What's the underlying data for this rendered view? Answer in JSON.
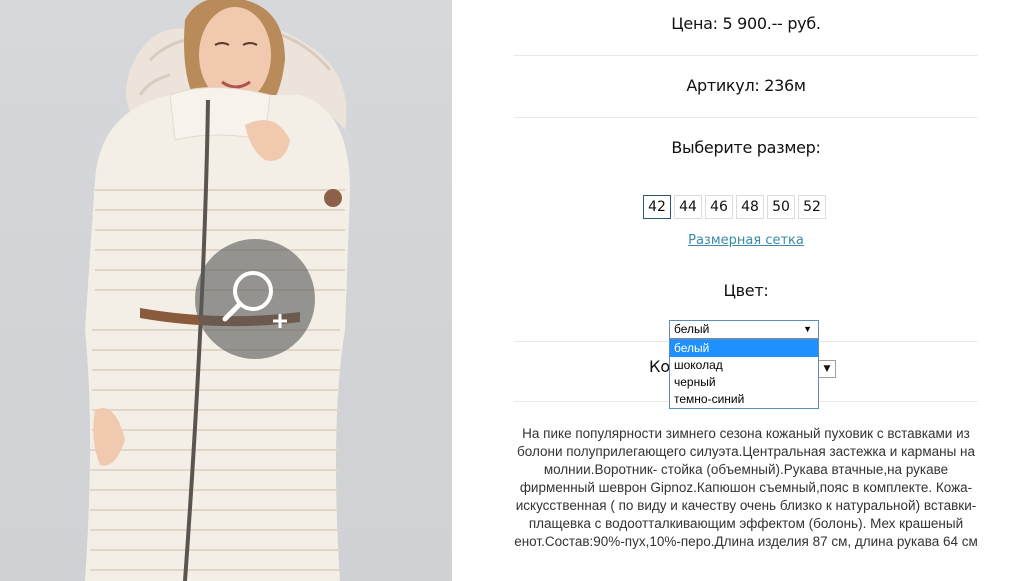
{
  "product": {
    "price_text": "Цена: 5 900.-- руб.",
    "article_text": "Артикул: 236м",
    "size_heading": "Выберите размер:",
    "sizes": [
      "42",
      "44",
      "46",
      "48",
      "50",
      "52"
    ],
    "selected_size": "42",
    "size_chart_link": "Размерная сетка",
    "color_heading": "Цвет:",
    "color_select": {
      "value": "белый",
      "options": [
        "белый",
        "шоколад",
        "черный",
        "темно-синий"
      ],
      "highlighted": "белый"
    },
    "quantity_label_partial": "Ко",
    "description": "На пике популярности зимнего сезона кожаный пуховик с вставками из болони полуприлегающего силуэта.Центральная застежка и карманы на молнии.Воротник- стойка (объемный).Рукава втачные,на рукаве фирменный шеврон Gipnoz.Капюшон съемный,пояс в комплекте. Кожа-искусственная ( по виду и качеству очень близко к натуральной) вставки-плащевка с водоотталкивающим эффектом (болонь). Мех крашеный енот.Состав:90%-пух,10%-перо.Длина изделия 87 см, длина рукава 64 см"
  },
  "icons": {
    "zoom": "zoom-in-magnifier-icon"
  },
  "colors": {
    "link": "#3b8aa8",
    "selected_size_border": "#2b5572",
    "dropdown_highlight": "#1e90ff"
  }
}
